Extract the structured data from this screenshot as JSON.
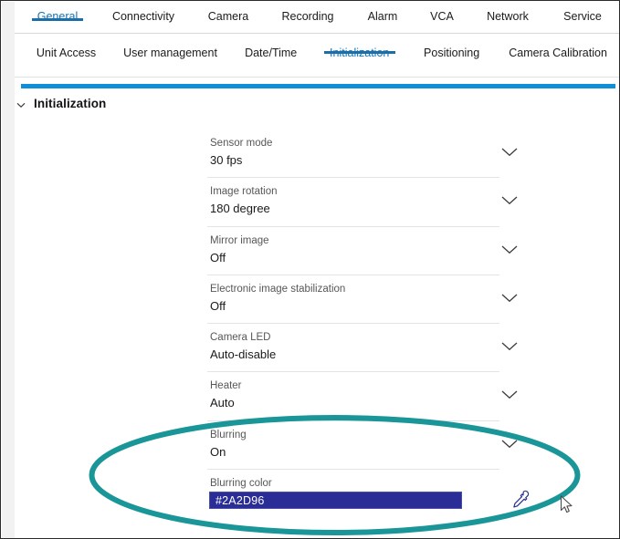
{
  "colors": {
    "accent_blue": "#0f8fd8",
    "tab_active_blue": "#1273b8",
    "tab_underline_blue": "#1b6ea8",
    "annotation_teal": "#1a9699",
    "blurring_color_swatch": "#2a2d96",
    "divider_gray": "#e4e4e4"
  },
  "main_tabs": [
    {
      "label": "General",
      "active": true
    },
    {
      "label": "Connectivity",
      "active": false
    },
    {
      "label": "Camera",
      "active": false
    },
    {
      "label": "Recording",
      "active": false
    },
    {
      "label": "Alarm",
      "active": false
    },
    {
      "label": "VCA",
      "active": false
    },
    {
      "label": "Network",
      "active": false
    },
    {
      "label": "Service",
      "active": false
    }
  ],
  "sub_tabs": [
    {
      "label": "Unit Access",
      "active": false
    },
    {
      "label": "User management",
      "active": false
    },
    {
      "label": "Date/Time",
      "active": false
    },
    {
      "label": "Initialization",
      "active": true
    },
    {
      "label": "Positioning",
      "active": false
    },
    {
      "label": "Camera Calibration",
      "active": false
    }
  ],
  "section": {
    "title": "Initialization",
    "expanded": true,
    "chevron_icon": "chevron-down-icon"
  },
  "settings": [
    {
      "label": "Sensor mode",
      "value": "30 fps",
      "control": "dropdown"
    },
    {
      "label": "Image rotation",
      "value": "180 degree",
      "control": "dropdown"
    },
    {
      "label": "Mirror image",
      "value": "Off",
      "control": "dropdown"
    },
    {
      "label": "Electronic image stabilization",
      "value": "Off",
      "control": "dropdown"
    },
    {
      "label": "Camera LED",
      "value": "Auto-disable",
      "control": "dropdown"
    },
    {
      "label": "Heater",
      "value": "Auto",
      "control": "dropdown"
    },
    {
      "label": "Blurring",
      "value": "On",
      "control": "dropdown"
    },
    {
      "label": "Blurring color",
      "value": "#2A2D96",
      "control": "color-swatch"
    }
  ],
  "icons": {
    "row_dropdown": "chevron-down-icon",
    "color_picker": "eyedropper-icon",
    "pointer": "mouse-cursor-icon"
  },
  "annotation": {
    "shape": "ellipse",
    "color": "#1a9699",
    "encircles": "Blurring and Blurring color rows"
  }
}
